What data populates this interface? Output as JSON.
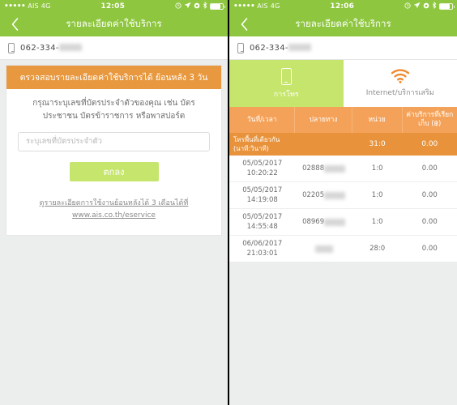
{
  "left": {
    "status_bar": {
      "signal_dots": "•••••",
      "carrier": "AIS",
      "network": "4G",
      "time": "12:05",
      "icons": [
        "alarm-icon",
        "location-arrow-icon",
        "rotation-lock-icon",
        "bluetooth-icon",
        "battery-icon"
      ]
    },
    "nav": {
      "back": "‹",
      "title": "รายละเอียดค่าใช้บริการ"
    },
    "phone": {
      "prefix": "062-334-"
    },
    "card": {
      "banner": "ตรวจสอบรายละเอียดค่าใช้บริการได้ ย้อนหลัง 3 วัน",
      "instruction": "กรุณาระบุเลขที่บัตรประจำตัวของคุณ เช่น บัตรประชาชน บัตรข้าราชการ หรือพาสปอร์ต",
      "input_placeholder": "ระบุเลขที่บัตรประจำตัว",
      "input_value": "",
      "submit_label": "ตกลง",
      "link_line1": "ดูรายละเอียดการใช้งานย้อนหลังได้ 3 เดือนได้ที่",
      "link_line2": "www.ais.co.th/eservice"
    }
  },
  "right": {
    "status_bar": {
      "signal_dots": "•••••",
      "carrier": "AIS",
      "network": "4G",
      "time": "12:06",
      "icons": [
        "alarm-icon",
        "location-arrow-icon",
        "rotation-lock-icon",
        "bluetooth-icon",
        "battery-icon"
      ]
    },
    "nav": {
      "back": "‹",
      "title": "รายละเอียดค่าใช้บริการ"
    },
    "phone": {
      "prefix": "062-334-"
    },
    "tabs": [
      {
        "label": "การโทร",
        "icon": "mobile-phone-icon",
        "active": true
      },
      {
        "label": "Internet/บริการเสริม",
        "icon": "wifi-icon",
        "active": false
      }
    ],
    "table": {
      "headers": [
        "วันที่/เวลา",
        "ปลายทาง",
        "หน่วย",
        "ค่าบริการที่เรียกเก็บ (฿)"
      ],
      "summary": {
        "label_line1": "โทรพื้นที่เดียวกัน",
        "label_line2": "(นาที:วินาที)",
        "destination": "",
        "units": "31:0",
        "charge": "0.00"
      },
      "rows": [
        {
          "date": "05/05/2017",
          "time": "10:20:22",
          "destination": "02888",
          "units": "1:0",
          "charge": "0.00"
        },
        {
          "date": "05/05/2017",
          "time": "14:19:08",
          "destination": "02205",
          "units": "1:0",
          "charge": "0.00"
        },
        {
          "date": "05/05/2017",
          "time": "14:55:48",
          "destination": "08969",
          "units": "1:0",
          "charge": "0.00"
        },
        {
          "date": "06/06/2017",
          "time": "21:03:01",
          "destination": "",
          "units": "28:0",
          "charge": "0.00"
        }
      ]
    }
  },
  "colors": {
    "nav_green": "#8ec63f",
    "accent_lime": "#c6e56c",
    "banner_orange": "#e8983e",
    "header_orange": "#f4a259",
    "page_bg": "#eceded"
  }
}
